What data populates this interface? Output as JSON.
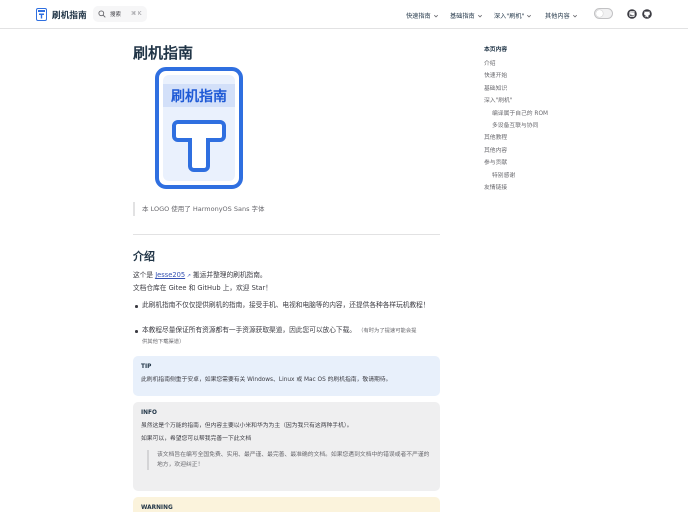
{
  "navbar": {
    "brand_title": "刷机指南",
    "search_placeholder": "搜索",
    "search_shortcut": "⌘ K",
    "menus": [
      {
        "label": "快速指南"
      },
      {
        "label": "基础指南"
      },
      {
        "label": "深入\"刷机\""
      },
      {
        "label": "其他内容"
      }
    ]
  },
  "doc": {
    "title": "刷机指南",
    "logo_text": "刷机指南",
    "logo_caption": "本 LOGO 使用了 HarmonyOS Sans 字体",
    "intro_heading": "介绍",
    "intro_prefix": "这个是 ",
    "intro_link": "Jesse205",
    "intro_suffix": " 搬运并整理的刷机指南。",
    "intro_line2": "文档仓库在 Gitee 和 GitHub 上，欢迎 Star！",
    "bullets": [
      {
        "text": "此刷机指南不仅仅提供刷机的指南，接受手机、电视和电脑等的内容，还提供各种各样玩机教程！"
      },
      {
        "text": "本教程尽量保证所有资源都有一手资源获取渠道，因此您可以放心下载。",
        "note": "（有时为了提速可能会提",
        "note2": "供其他下载渠道）"
      }
    ],
    "tip": {
      "title": "TIP",
      "text": "此刷机指南侧重于安卓，如果您需要有关 Windows、Linux 或 Mac OS 的刷机指南，敬请期待。"
    },
    "info": {
      "title": "INFO",
      "line1": "虽然这是个万能的指南，但内容主要以小米和华为为主（因为我只有这两种手机）。",
      "line2": "如果可以，希望您可以帮我完善一下此文档",
      "quote": "该文档旨在编写全国免费、实用、最严谨、最完善、最准确的文档。如果您遇到文档中的错误或者不严谨的地方，欢迎纠正！"
    },
    "warning": {
      "title": "WARNING"
    }
  },
  "outline": {
    "title": "本页内容",
    "items": [
      {
        "label": "介绍"
      },
      {
        "label": "快速开始"
      },
      {
        "label": "基础知识"
      },
      {
        "label": "深入\"刷机\""
      },
      {
        "label": "编译属于自己的 ROM"
      },
      {
        "label": "多设备互联与协同"
      },
      {
        "label": "其他教程"
      },
      {
        "label": "其他内容"
      },
      {
        "label": "参与贡献"
      },
      {
        "label": "特别感谢"
      },
      {
        "label": "友情链接"
      }
    ]
  },
  "colors": {
    "brand": "#3451b2",
    "logo_blue": "#2f6fe0",
    "tip_bg": "#e8f0fb",
    "info_bg": "#efeff0",
    "warning_bg": "#fbf3dc"
  }
}
